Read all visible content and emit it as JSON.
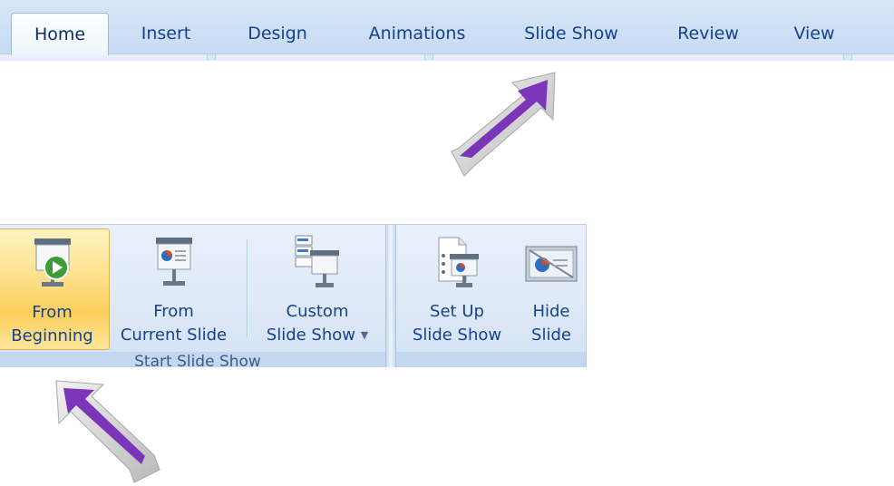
{
  "tabs": [
    {
      "label": "Home",
      "active": true
    },
    {
      "label": "Insert"
    },
    {
      "label": "Design"
    },
    {
      "label": "Animations"
    },
    {
      "label": "Slide Show"
    },
    {
      "label": "Review"
    },
    {
      "label": "View"
    }
  ],
  "ribbon": {
    "start_group_label": "Start Slide Show",
    "buttons": {
      "from_beginning": {
        "line1": "From",
        "line2": "Beginning",
        "icon": "presentation-play-icon"
      },
      "from_current": {
        "line1": "From",
        "line2": "Current Slide",
        "icon": "presentation-screen-icon"
      },
      "custom_show": {
        "line1": "Custom",
        "line2": "Slide Show",
        "icon": "custom-slide-show-icon"
      },
      "set_up": {
        "line1": "Set Up",
        "line2": "Slide Show",
        "icon": "set-up-slide-show-icon"
      },
      "hide_slide": {
        "line1": "Hide",
        "line2": "Slide",
        "icon": "hide-slide-icon"
      }
    }
  },
  "colors": {
    "tab_text": "#15428b",
    "hover_button": "#fbcf5c",
    "arrow_fill": "#7a35b8"
  }
}
